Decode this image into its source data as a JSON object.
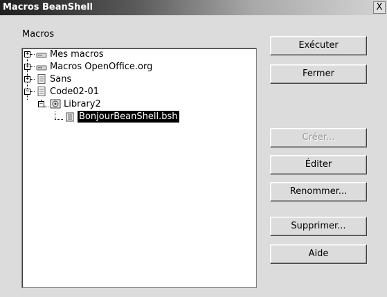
{
  "window": {
    "title": "Macros BeanShell",
    "close_label": "X"
  },
  "macros_label": "Macros",
  "tree": [
    {
      "label": "Mes macros",
      "icon": "drive-icon",
      "expander": "+"
    },
    {
      "label": "Macros OpenOffice.org",
      "icon": "drive-icon",
      "expander": "+"
    },
    {
      "label": "Sans",
      "icon": "document-icon",
      "expander": "+"
    },
    {
      "label": "Code02-01",
      "icon": "document-icon",
      "expander": "−"
    },
    {
      "label": "Library2",
      "icon": "library-icon",
      "expander": "−"
    },
    {
      "label": "BonjourBeanShell.bsh",
      "icon": "script-icon",
      "selected": true
    }
  ],
  "buttons": {
    "execute": "Exécuter",
    "close": "Fermer",
    "create": "Créer...",
    "edit": "Éditer",
    "rename": "Renommer...",
    "delete": "Supprimer...",
    "help": "Aide"
  }
}
